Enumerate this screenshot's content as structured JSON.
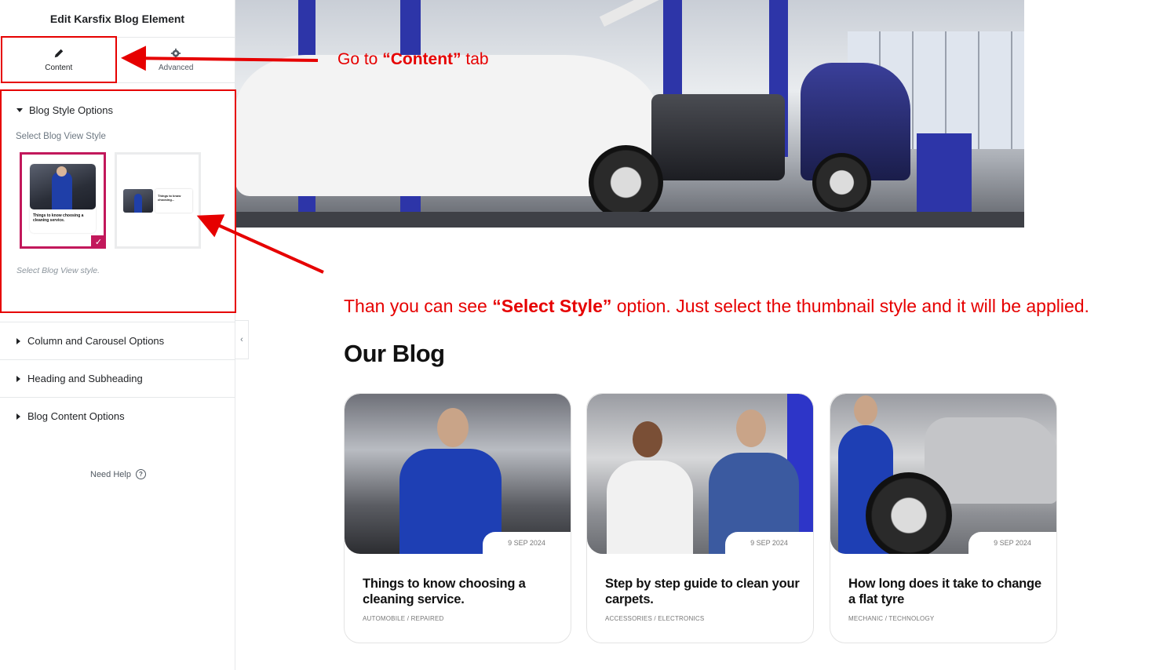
{
  "panel": {
    "title": "Edit Karsfix Blog Element",
    "tabs": [
      {
        "label": "Content",
        "icon": "pencil-icon",
        "active": true
      },
      {
        "label": "Advanced",
        "icon": "gear-icon",
        "active": false
      }
    ],
    "sections": [
      {
        "label": "Blog Style Options",
        "expanded": true
      },
      {
        "label": "Column and Carousel Options",
        "expanded": false
      },
      {
        "label": "Heading and Subheading",
        "expanded": false
      },
      {
        "label": "Blog Content Options",
        "expanded": false
      }
    ],
    "blog_style": {
      "control_label": "Select Blog View Style",
      "hint": "Select Blog View style.",
      "thumb1_text": "Things to know choosing a cleaning service.",
      "thumb2_text": "Things to know choosing..."
    },
    "need_help": "Need Help",
    "accent": "#c2185b"
  },
  "annotations": {
    "goto_prefix": "Go  to ",
    "goto_bold": "“Content”",
    "goto_suffix": " tab",
    "then_prefix": "Than you can see ",
    "then_bold": "“Select Style”",
    "then_suffix": " option. Just select the thumbnail style and it will be applied.",
    "color": "#e60000"
  },
  "blog": {
    "heading": "Our Blog",
    "cards": [
      {
        "date": "9 SEP 2024",
        "title": "Things to know choosing a cleaning service.",
        "categories": "AUTOMOBILE / REPAIRED"
      },
      {
        "date": "9 SEP 2024",
        "title": "Step by step guide to clean your carpets.",
        "categories": "ACCESSORIES / ELECTRONICS"
      },
      {
        "date": "9 SEP 2024",
        "title": "How long does it take to change a flat tyre",
        "categories": "MECHANIC / TECHNOLOGY"
      }
    ]
  }
}
